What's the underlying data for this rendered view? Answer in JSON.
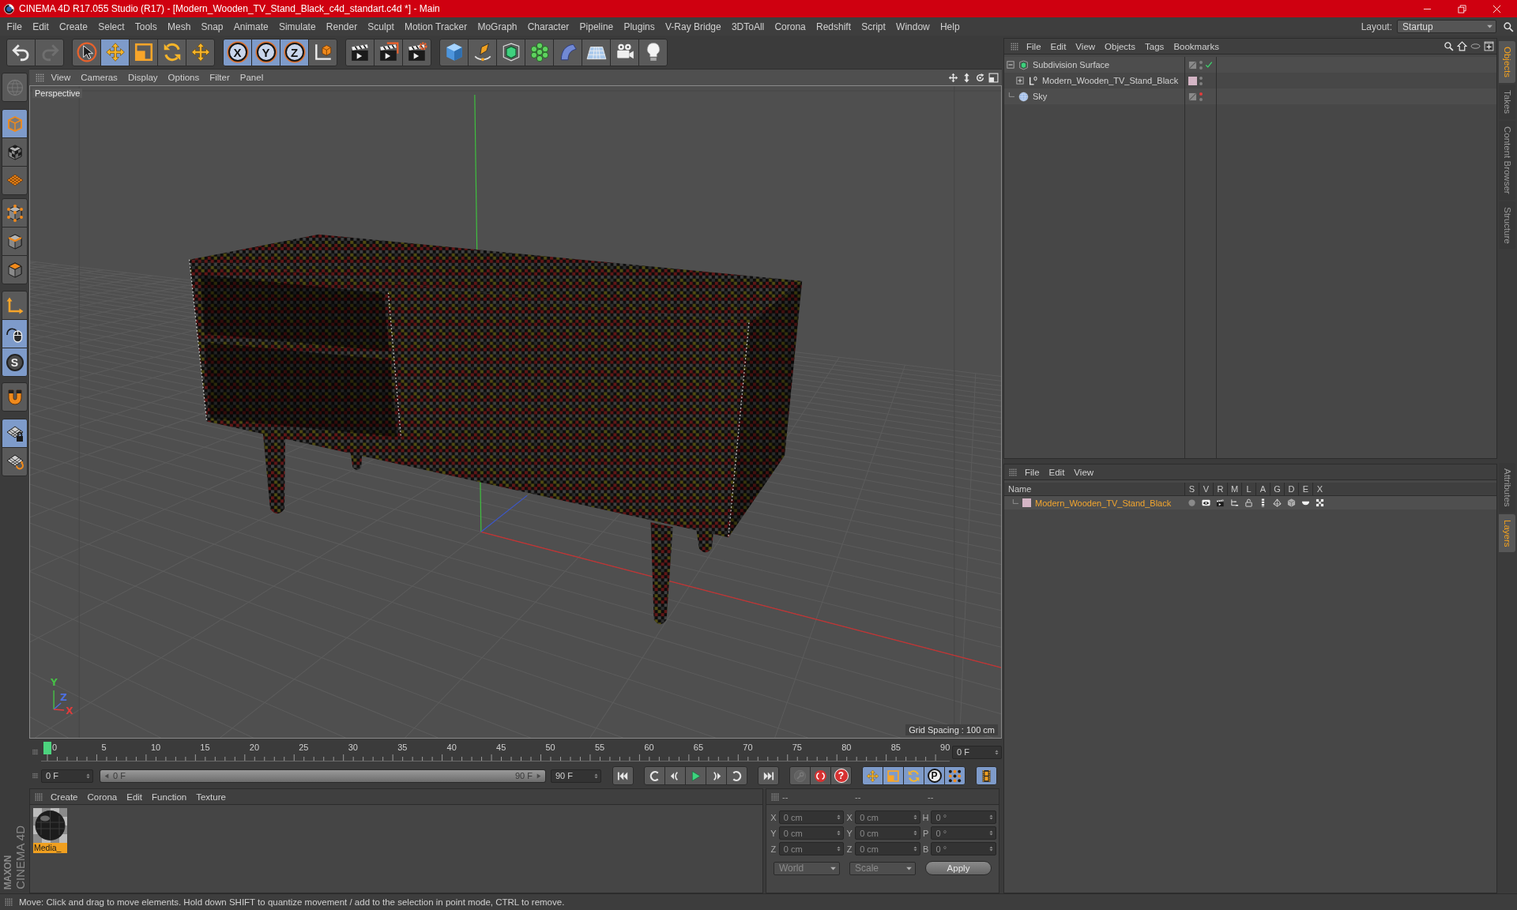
{
  "window": {
    "title": "CINEMA 4D R17.055 Studio (R17) - [Modern_Wooden_TV_Stand_Black_c4d_standart.c4d *] - Main"
  },
  "menu_bar": {
    "items": [
      "File",
      "Edit",
      "Create",
      "Select",
      "Tools",
      "Mesh",
      "Snap",
      "Animate",
      "Simulate",
      "Render",
      "Sculpt",
      "Motion Tracker",
      "MoGraph",
      "Character",
      "Pipeline",
      "Plugins",
      "V-Ray Bridge",
      "3DToAll",
      "Corona",
      "Redshift",
      "Script",
      "Window",
      "Help"
    ],
    "layout_label": "Layout:",
    "layout_value": "Startup"
  },
  "toolbar": [
    [
      {
        "kind": "undo",
        "on": false,
        "disabled": false
      },
      {
        "kind": "redo",
        "on": false,
        "disabled": true
      }
    ],
    [
      {
        "kind": "select",
        "on": false,
        "disabled": false
      },
      {
        "kind": "move",
        "on": true,
        "disabled": false
      },
      {
        "kind": "scale",
        "on": false,
        "disabled": false
      },
      {
        "kind": "rotate",
        "on": false,
        "disabled": false
      },
      {
        "kind": "move",
        "on": false,
        "disabled": false
      }
    ],
    [
      {
        "kind": "axis",
        "label": "X",
        "on": true,
        "disabled": false
      },
      {
        "kind": "axis",
        "label": "Y",
        "on": true,
        "disabled": false
      },
      {
        "kind": "axis",
        "label": "Z",
        "on": true,
        "disabled": false
      },
      {
        "kind": "coords",
        "on": false,
        "disabled": false
      }
    ],
    [
      {
        "kind": "render_view",
        "on": false,
        "disabled": false
      },
      {
        "kind": "render_pv",
        "on": false,
        "disabled": false
      },
      {
        "kind": "render_settings",
        "on": false,
        "disabled": false
      }
    ],
    [
      {
        "kind": "cube",
        "on": false,
        "disabled": false
      },
      {
        "kind": "pen",
        "on": false,
        "disabled": false
      },
      {
        "kind": "subdiv",
        "on": false,
        "disabled": false
      },
      {
        "kind": "cloner",
        "on": false,
        "disabled": false
      },
      {
        "kind": "bend",
        "on": false,
        "disabled": false
      },
      {
        "kind": "floor",
        "on": false,
        "disabled": false
      },
      {
        "kind": "camera",
        "on": false,
        "disabled": false
      },
      {
        "kind": "light",
        "on": false,
        "disabled": false
      }
    ]
  ],
  "left_toolbar": [
    [
      {
        "kind": "globe",
        "on": false,
        "disabled": true
      }
    ],
    [
      {
        "kind": "model",
        "on": true,
        "disabled": false
      },
      {
        "kind": "texture",
        "on": false,
        "disabled": false
      },
      {
        "kind": "workplane",
        "on": false,
        "disabled": false
      }
    ],
    [
      {
        "kind": "points",
        "on": false,
        "disabled": false
      },
      {
        "kind": "edges",
        "on": false,
        "disabled": false
      },
      {
        "kind": "polygons",
        "on": false,
        "disabled": false
      }
    ],
    [
      {
        "kind": "axis_mode",
        "on": false,
        "disabled": false
      },
      {
        "kind": "tweak",
        "on": true,
        "disabled": false
      },
      {
        "kind": "letter",
        "label": "S",
        "on": true,
        "disabled": false
      }
    ],
    [
      {
        "kind": "magnet",
        "on": false,
        "disabled": false
      }
    ],
    [
      {
        "kind": "lockgrid",
        "on": true,
        "disabled": false
      },
      {
        "kind": "gridcycle",
        "on": false,
        "disabled": false
      }
    ]
  ],
  "viewport": {
    "menu": [
      "View",
      "Cameras",
      "Display",
      "Options",
      "Filter",
      "Panel"
    ],
    "camera": "Perspective",
    "grid_spacing": "Grid Spacing : 100 cm",
    "gizmo": [
      {
        "label": "Y",
        "color": "#46c046"
      },
      {
        "label": "Z",
        "color": "#4d6fe0"
      },
      {
        "label": "X",
        "color": "#e03c3c"
      }
    ]
  },
  "timeline": {
    "ticks": [
      "0",
      "5",
      "10",
      "15",
      "20",
      "25",
      "30",
      "35",
      "40",
      "45",
      "50",
      "55",
      "60",
      "65",
      "70",
      "75",
      "80",
      "85",
      "90"
    ],
    "level": 0,
    "current_frame": "0 F"
  },
  "playback": {
    "start": "0 F",
    "range": {
      "start": "0 F",
      "end": "90 F",
      "level": 1
    },
    "end": "90 F",
    "transport": [
      [
        {
          "kind": "first"
        }
      ],
      [
        {
          "kind": "prev_key"
        },
        {
          "kind": "prev_frame"
        },
        {
          "kind": "play"
        },
        {
          "kind": "next_frame"
        },
        {
          "kind": "next_key"
        }
      ],
      [
        {
          "kind": "last"
        }
      ]
    ],
    "record": [
      {
        "kind": "key",
        "on": false,
        "disabled": true
      },
      {
        "kind": "record",
        "on": false,
        "disabled": false
      },
      {
        "kind": "autokey",
        "label": "?",
        "on": false,
        "disabled": false
      }
    ],
    "key_modes": [
      {
        "kind": "key_move",
        "on": true,
        "disabled": false
      },
      {
        "kind": "key_scale",
        "on": true,
        "disabled": false
      },
      {
        "kind": "key_rotate",
        "on": true,
        "disabled": false
      },
      {
        "kind": "param",
        "label": "P",
        "on": true,
        "disabled": false
      },
      {
        "kind": "pla",
        "on": true,
        "disabled": false
      }
    ],
    "film": {
      "kind": "film",
      "on": true,
      "disabled": false
    }
  },
  "material_manager": {
    "menu": [
      "Create",
      "Corona",
      "Edit",
      "Function",
      "Texture"
    ],
    "materials": [
      {
        "name": "Media_",
        "selected": true
      }
    ]
  },
  "coordinates": {
    "headers": [
      "--",
      "--",
      "--"
    ],
    "rows": [
      {
        "labels": [
          "X",
          "X",
          "H"
        ],
        "values": [
          "0 cm",
          "0 cm",
          "0 °"
        ]
      },
      {
        "labels": [
          "Y",
          "Y",
          "P"
        ],
        "values": [
          "0 cm",
          "0 cm",
          "0 °"
        ]
      },
      {
        "labels": [
          "Z",
          "Z",
          "B"
        ],
        "values": [
          "0 cm",
          "0 cm",
          "0 °"
        ]
      }
    ],
    "dropdowns": [
      "World",
      "Scale"
    ],
    "apply": "Apply"
  },
  "brand": {
    "maker": "MAXON",
    "product": "CINEMA 4D"
  },
  "object_manager": {
    "menu": [
      "File",
      "Edit",
      "View",
      "Objects",
      "Tags",
      "Bookmarks"
    ],
    "objects": [
      {
        "name": "Subdivision Surface",
        "kind": "subdivision",
        "expanded": true,
        "editor_visible": true,
        "render_visible": true,
        "enabled": true,
        "children": [
          {
            "name": "Modern_Wooden_TV_Stand_Black",
            "kind": "null",
            "expanded": false,
            "color": "#d4b5c5",
            "editor_visible": true,
            "render_visible": true,
            "enabled": false
          }
        ]
      },
      {
        "name": "Sky",
        "kind": "sky",
        "editor_visible": false,
        "render_visible": true,
        "enabled": false
      }
    ]
  },
  "layer_manager": {
    "menu": [
      "File",
      "Edit",
      "View"
    ],
    "columns": [
      "Name",
      "S",
      "V",
      "R",
      "M",
      "L",
      "A",
      "G",
      "D",
      "E",
      "X"
    ],
    "layers": [
      {
        "name": "Modern_Wooden_TV_Stand_Black",
        "color": "#d4b5c5",
        "selected": true
      }
    ]
  },
  "side_tabs": {
    "upper": [
      {
        "label": "Objects",
        "selected": true
      },
      {
        "label": "Takes",
        "selected": false
      },
      {
        "label": "Content Browser",
        "selected": false
      },
      {
        "label": "Structure",
        "selected": false
      }
    ],
    "lower": [
      {
        "label": "Attributes",
        "selected": false
      },
      {
        "label": "Layers",
        "selected": true
      }
    ]
  },
  "status_bar": {
    "text": "Move: Click and drag to move elements. Hold down SHIFT to quantize movement / add to the selection in point mode, CTRL to remove."
  }
}
